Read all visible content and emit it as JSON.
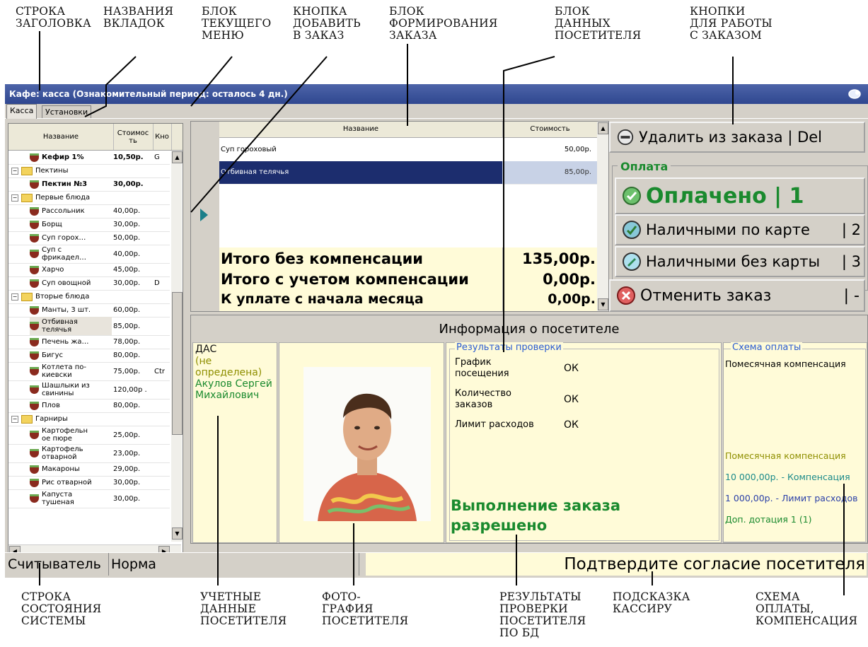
{
  "callouts": {
    "title_row": "СТРОКА\nЗАГОЛОВКА",
    "tab_names": "НАЗВАНИЯ\nВКЛАДОК",
    "menu_block": "БЛОК\nТЕКУЩЕГО\nМЕНЮ",
    "add_button": "КНОПКА\nДОБАВИТЬ\nВ ЗАКАЗ",
    "order_block": "БЛОК\nФОРМИРОВАНИЯ\nЗАКАЗА",
    "visitor_block": "БЛОК\nДАННЫХ\nПОСЕТИТЕЛЯ",
    "order_buttons": "КНОПКИ\nДЛЯ РАБОТЫ\nС ЗАКАЗОМ",
    "status_row": "СТРОКА\nСОСТОЯНИЯ\nСИСТЕМЫ",
    "account_data": "УЧЕТНЫЕ\nДАННЫЕ\nПОСЕТИТЕЛЯ",
    "photo": "ФОТО-\nГРАФИЯ\nПОСЕТИТЕЛЯ",
    "check_results": "РЕЗУЛЬТАТЫ\nПРОВЕРКИ\nПОСЕТИТЕЛЯ\nПО БД",
    "cashier_hint": "ПОДСКАЗКА\nКАССИРУ",
    "payment_scheme": "СХЕМА\nОПЛАТЫ,\nКОМПЕНСАЦИЯ"
  },
  "window": {
    "title": "Кафе: касса (Ознакомительный период: осталось 4 дн.)",
    "tabs": [
      "Касса",
      "Установки"
    ]
  },
  "menu": {
    "headers": [
      "Название",
      "Стоимос ть",
      "Кно"
    ],
    "rows": [
      {
        "kind": "item",
        "name": "Кефир 1%",
        "price": "10,50р.",
        "code": "G",
        "bold": true
      },
      {
        "kind": "group",
        "name": "Пектины"
      },
      {
        "kind": "item",
        "name": "Пектин №3",
        "price": "30,00р.",
        "code": "",
        "bold": true
      },
      {
        "kind": "group",
        "name": "Первые блюда"
      },
      {
        "kind": "item",
        "name": "Рассольник",
        "price": "40,00р.",
        "code": ""
      },
      {
        "kind": "item",
        "name": "Борщ",
        "price": "30,00р.",
        "code": ""
      },
      {
        "kind": "item",
        "name": "Суп горох…",
        "price": "50,00р.",
        "code": ""
      },
      {
        "kind": "item2",
        "name": "Суп с фрикадел…",
        "price": "40,00р.",
        "code": ""
      },
      {
        "kind": "item",
        "name": "Харчо",
        "price": "45,00р.",
        "code": ""
      },
      {
        "kind": "item",
        "name": "Суп овощной",
        "price": "30,00р.",
        "code": "D"
      },
      {
        "kind": "group",
        "name": "Вторые блюда"
      },
      {
        "kind": "item",
        "name": "Манты, 3 шт.",
        "price": "60,00р.",
        "code": ""
      },
      {
        "kind": "item2",
        "name": "Отбивная телячья",
        "price": "85,00р.",
        "code": "",
        "selected": true
      },
      {
        "kind": "item",
        "name": "Печень жа…",
        "price": "78,00р.",
        "code": ""
      },
      {
        "kind": "item",
        "name": "Бигус",
        "price": "80,00р.",
        "code": ""
      },
      {
        "kind": "item2",
        "name": "Котлета по-киевски",
        "price": "75,00р.",
        "code": "Ctr"
      },
      {
        "kind": "item2",
        "name": "Шашлыки из свинины",
        "price": "120,00р .",
        "code": ""
      },
      {
        "kind": "item",
        "name": "Плов",
        "price": "80,00р.",
        "code": ""
      },
      {
        "kind": "group",
        "name": "Гарниры"
      },
      {
        "kind": "item2",
        "name": "Картофельн ое пюре",
        "price": "25,00р.",
        "code": ""
      },
      {
        "kind": "item2",
        "name": "Картофель отварной",
        "price": "23,00р.",
        "code": ""
      },
      {
        "kind": "item",
        "name": "Макароны",
        "price": "29,00р.",
        "code": ""
      },
      {
        "kind": "item",
        "name": "Рис отварной",
        "price": "30,00р.",
        "code": ""
      },
      {
        "kind": "item2",
        "name": "Капуста тушеная",
        "price": "30,00р.",
        "code": ""
      }
    ]
  },
  "order": {
    "headers": {
      "name": "Название",
      "price": "Стоимость"
    },
    "rows": [
      {
        "name": "Суп гороховый",
        "price": "50,00р."
      },
      {
        "name": "Отбивная телячья",
        "price": "85,00р."
      }
    ],
    "totals": [
      {
        "label": "Итого без компенсации",
        "value": "135,00р."
      },
      {
        "label": "Итого с учетом компенсации",
        "value": "0,00р."
      },
      {
        "label": "К уплате с начала месяца",
        "value": "0,00р."
      }
    ]
  },
  "actions": {
    "delete": "Удалить из заказа | Del",
    "payment_group": "Оплата",
    "paid": "Оплачено | 1",
    "cash_card": "Наличными по карте",
    "cash_card_key": "| 2",
    "cash_nocard": "Наличными без карты",
    "cash_nocard_key": "| 3",
    "cancel": "Отменить заказ",
    "cancel_key": "| -"
  },
  "visitor": {
    "title": "Информация о посетителе",
    "dept": "ДАС",
    "category": "(не определена)",
    "name": "Акулов Сергей Михайлович",
    "checks_title": "Результаты проверки",
    "checks": [
      {
        "label": "График посещения",
        "value": "ОК"
      },
      {
        "label": "Количество заказов",
        "value": "ОК"
      },
      {
        "label": "Лимит расходов",
        "value": "ОК"
      }
    ],
    "verdict": "Выполнение заказа разрешено",
    "scheme_title": "Схема оплаты",
    "scheme": "Помесячная компенсация",
    "scheme_detail_1": "Помесячная компенсация",
    "scheme_detail_2": "10 000,00р. - Компенсация",
    "scheme_detail_3": "1 000,00р. - Лимит расходов",
    "scheme_detail_4": "Доп. дотация 1 (1)"
  },
  "status": {
    "reader": "Считыватель",
    "state": "Норма",
    "hint": "Подтвердите согласие посетителя"
  },
  "colors": {
    "title_bar": "#2f4790",
    "accent_green": "#1a8a2e",
    "panel_yellow": "#fffbd8",
    "link_blue": "#2a5bd1"
  }
}
